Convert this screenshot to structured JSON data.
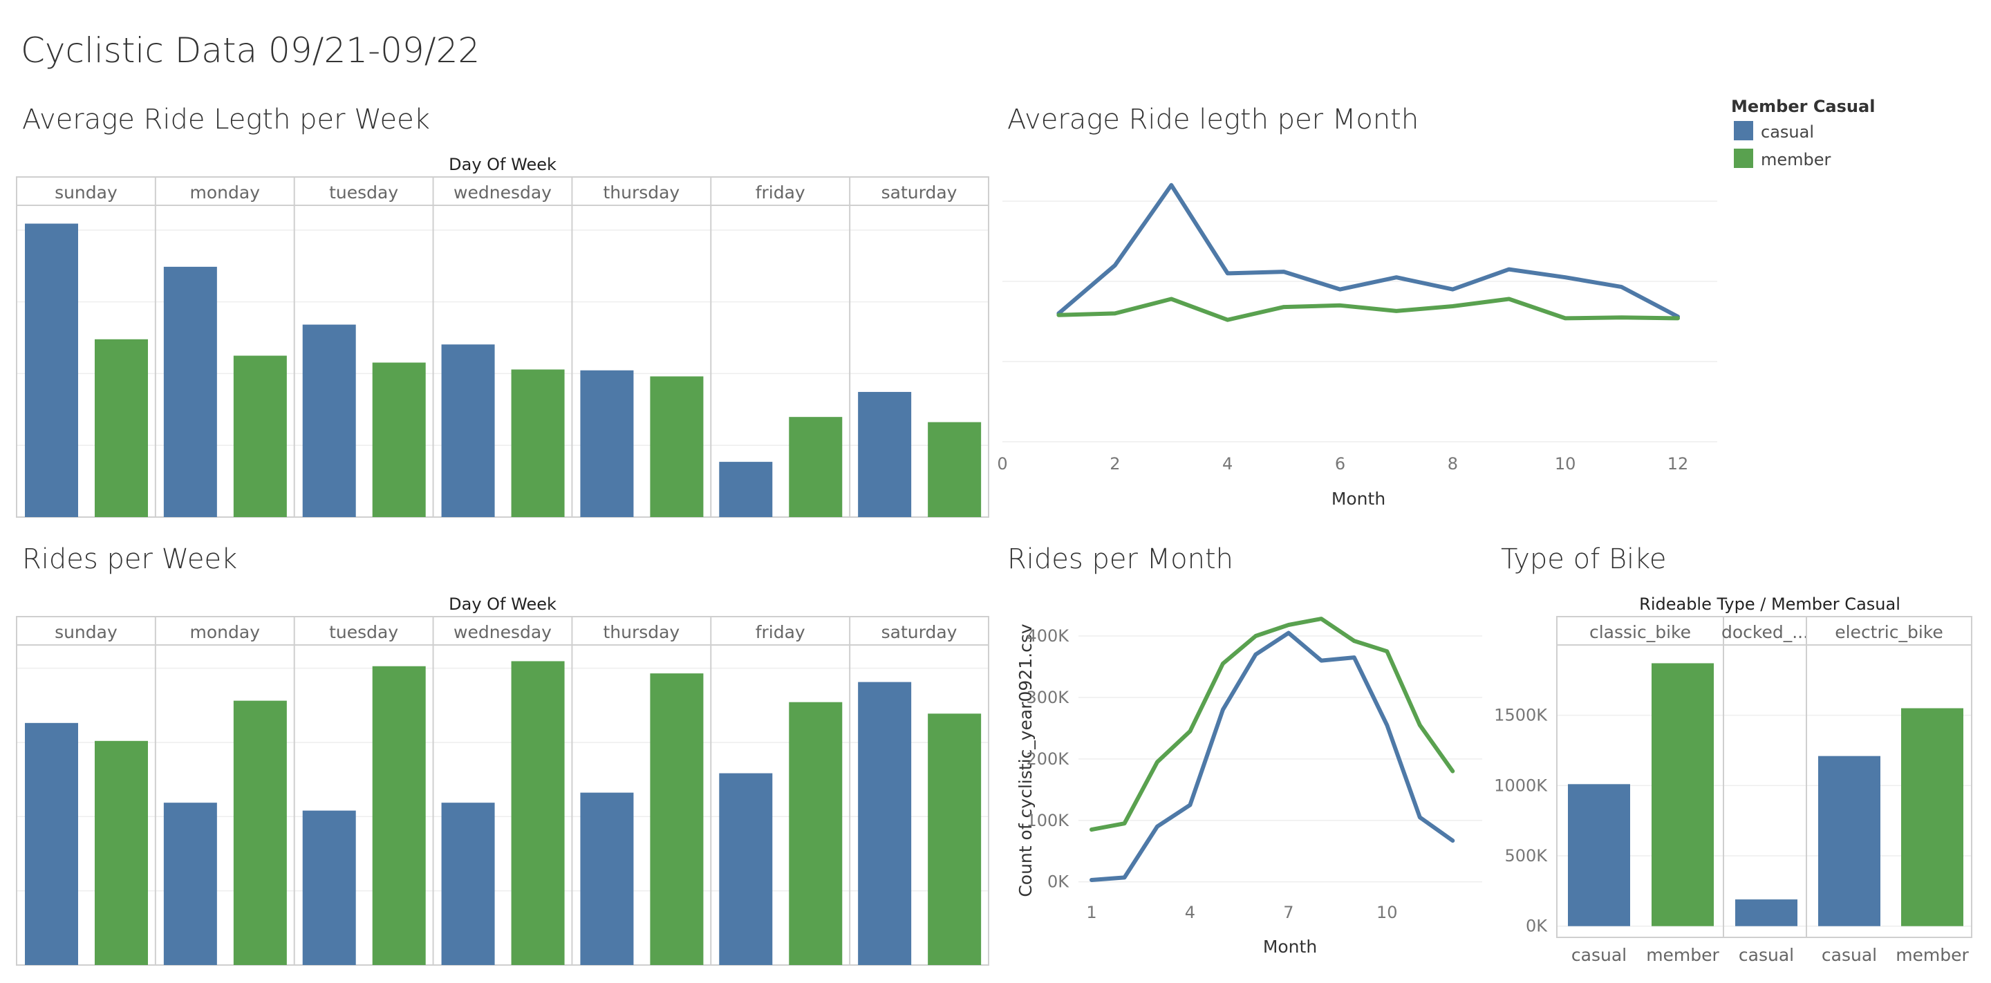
{
  "dashboard_title": "Cyclistic Data 09/21-09/22",
  "colors": {
    "casual": "#4e79a7",
    "member": "#59a14f"
  },
  "legend": {
    "title": "Member Casual",
    "items": [
      {
        "label": "casual",
        "color": "#4e79a7"
      },
      {
        "label": "member",
        "color": "#59a14f"
      }
    ]
  },
  "chart_data": [
    {
      "id": "ride-length-week",
      "type": "bar",
      "title": "Average Ride Legth per Week",
      "header_title": "Day Of Week",
      "categories": [
        "sunday",
        "monday",
        "tuesday",
        "wednesday",
        "thursday",
        "friday",
        "saturday"
      ],
      "series": [
        {
          "name": "casual",
          "values": [
            34.0,
            29.0,
            22.3,
            20.0,
            17.0,
            6.4,
            14.5
          ]
        },
        {
          "name": "member",
          "values": [
            20.6,
            18.7,
            17.9,
            17.1,
            16.3,
            11.6,
            11.0
          ]
        }
      ],
      "ylim": [
        0,
        35
      ],
      "grid": true,
      "y_axis_shown": false
    },
    {
      "id": "ride-length-month",
      "type": "line",
      "title": "Average Ride  legth per Month",
      "xlabel": "Month",
      "x": [
        1,
        2,
        3,
        4,
        5,
        6,
        7,
        8,
        9,
        10,
        11,
        12
      ],
      "series": [
        {
          "name": "casual",
          "values": [
            16.0,
            22.0,
            32.0,
            21.0,
            21.2,
            19.0,
            20.5,
            19.0,
            21.5,
            20.5,
            19.3,
            15.6
          ]
        },
        {
          "name": "member",
          "values": [
            15.8,
            16.0,
            17.8,
            15.2,
            16.8,
            17.0,
            16.3,
            16.9,
            17.8,
            15.4,
            15.5,
            15.4
          ]
        }
      ],
      "xlim": [
        0,
        12.7
      ],
      "xticks": [
        0,
        2,
        4,
        6,
        8,
        10,
        12
      ],
      "ylim": [
        0,
        35
      ],
      "grid": true,
      "y_axis_shown": false
    },
    {
      "id": "rides-week",
      "type": "bar",
      "title": "Rides per Week",
      "header_title": "Day Of Week",
      "categories": [
        "sunday",
        "monday",
        "tuesday",
        "wednesday",
        "thursday",
        "friday",
        "saturday"
      ],
      "series": [
        {
          "name": "casual",
          "values": [
            337000,
            226000,
            215000,
            226000,
            240000,
            267000,
            394000
          ]
        },
        {
          "name": "member",
          "values": [
            312000,
            368000,
            416000,
            423000,
            406000,
            366000,
            350000
          ]
        }
      ],
      "ylim": [
        0,
        435000
      ],
      "grid": true,
      "y_axis_shown": false
    },
    {
      "id": "rides-month",
      "type": "line",
      "title": "Rides per Month",
      "xlabel": "Month",
      "ylabel": "Count of cyclistic_year0921.csv",
      "x": [
        1,
        2,
        3,
        4,
        5,
        6,
        7,
        8,
        9,
        10,
        11,
        12
      ],
      "series": [
        {
          "name": "casual",
          "values": [
            3000,
            7000,
            90000,
            125000,
            280000,
            370000,
            405000,
            360000,
            365000,
            255000,
            105000,
            67000
          ]
        },
        {
          "name": "member",
          "values": [
            85000,
            95000,
            195000,
            245000,
            355000,
            400000,
            418000,
            428000,
            392000,
            375000,
            255000,
            180000
          ]
        }
      ],
      "yticks": [
        0,
        100000,
        200000,
        300000,
        400000
      ],
      "ytick_labels": [
        "0K",
        "100K",
        "200K",
        "300K",
        "400K"
      ],
      "xticks": [
        1,
        4,
        7,
        10
      ],
      "xlim": [
        0.6,
        12.9
      ],
      "ylim": [
        -15000,
        445000
      ],
      "grid": true
    },
    {
      "id": "bike-type",
      "type": "bar",
      "title": "Type of Bike",
      "header_title": "Rideable Type  /  Member Casual",
      "groups": [
        {
          "label": "classic_bike",
          "bars": [
            {
              "label": "casual",
              "value": 1010000
            },
            {
              "label": "member",
              "value": 1870000
            }
          ]
        },
        {
          "label": "docked_...",
          "bars": [
            {
              "label": "casual",
              "value": 190000
            }
          ]
        },
        {
          "label": "electric_bike",
          "bars": [
            {
              "label": "casual",
              "value": 1210000
            },
            {
              "label": "member",
              "value": 1550000
            }
          ]
        }
      ],
      "yticks": [
        0,
        500000,
        1000000,
        1500000
      ],
      "ytick_labels": [
        "0K",
        "500K",
        "1000K",
        "1500K"
      ],
      "ylim": [
        -80000,
        2000000
      ],
      "grid": true
    }
  ]
}
